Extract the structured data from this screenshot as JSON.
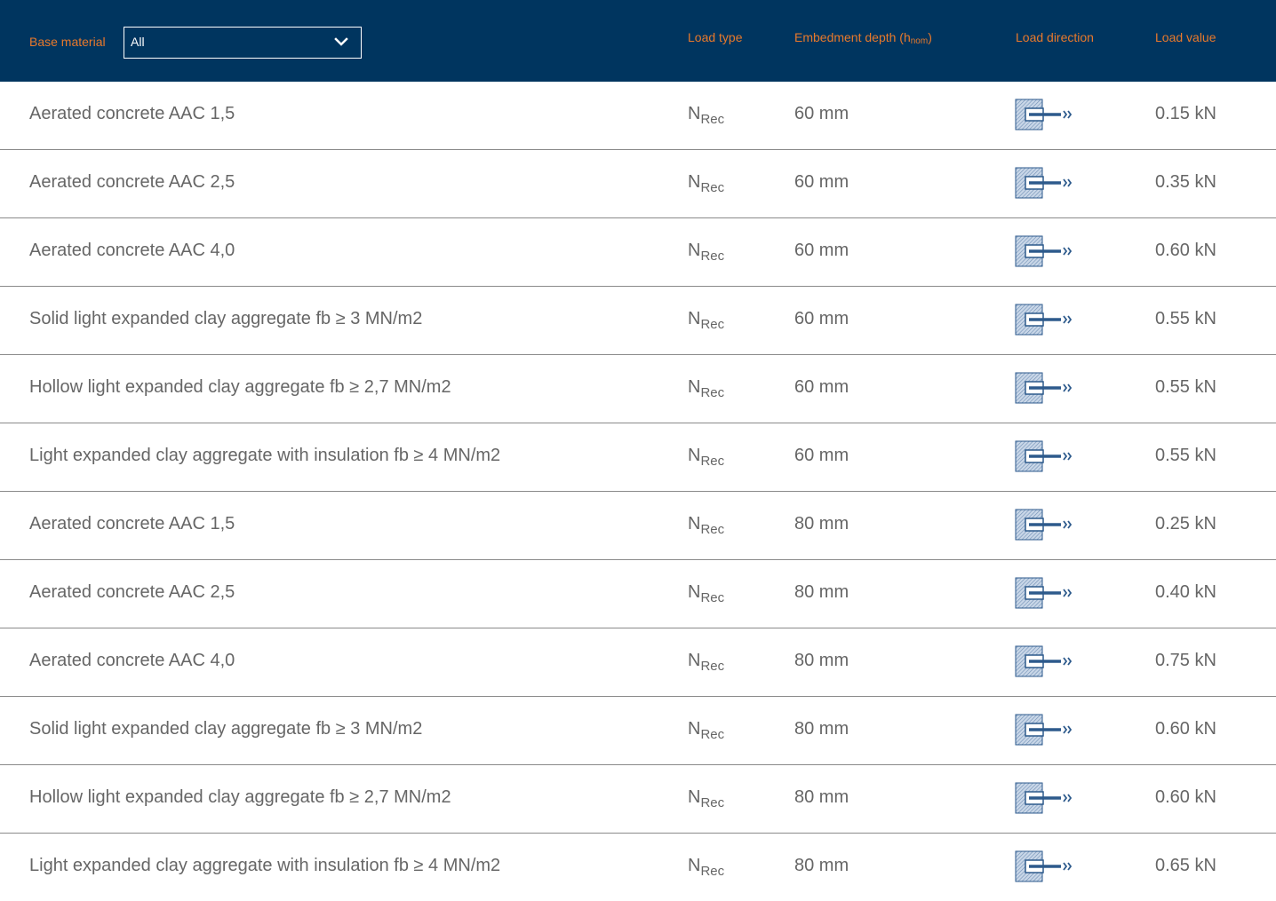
{
  "header": {
    "base_material_label": "Base material",
    "base_material_select": {
      "selected": "All"
    },
    "load_type_label": "Load type",
    "embedment_depth_label": "Embedment depth (h",
    "embedment_depth_sub": "nom",
    "embedment_depth_close": ")",
    "load_direction_label": "Load direction",
    "load_value_label": "Load value"
  },
  "icons": {
    "dropdown": "chevron-down-icon",
    "load_direction": "tension-load-direction-icon"
  },
  "colors": {
    "header_bg": "#00355f",
    "header_text": "#e8792b",
    "body_text": "#666666",
    "divider": "#8a8a8a"
  },
  "rows": [
    {
      "material": "Aerated concrete AAC 1,5",
      "load_type": "N",
      "load_type_sub": "Rec",
      "depth": "60 mm",
      "value": "0.15 kN"
    },
    {
      "material": "Aerated concrete AAC 2,5",
      "load_type": "N",
      "load_type_sub": "Rec",
      "depth": "60 mm",
      "value": "0.35 kN"
    },
    {
      "material": "Aerated concrete AAC 4,0",
      "load_type": "N",
      "load_type_sub": "Rec",
      "depth": "60 mm",
      "value": "0.60 kN"
    },
    {
      "material": "Solid light expanded clay aggregate fb ≥ 3 MN/m2",
      "load_type": "N",
      "load_type_sub": "Rec",
      "depth": "60 mm",
      "value": "0.55 kN"
    },
    {
      "material": "Hollow light expanded clay aggregate fb ≥ 2,7 MN/m2",
      "load_type": "N",
      "load_type_sub": "Rec",
      "depth": "60 mm",
      "value": "0.55 kN"
    },
    {
      "material": "Light expanded clay aggregate with insulation fb ≥ 4 MN/m2",
      "load_type": "N",
      "load_type_sub": "Rec",
      "depth": "60 mm",
      "value": "0.55 kN"
    },
    {
      "material": "Aerated concrete AAC 1,5",
      "load_type": "N",
      "load_type_sub": "Rec",
      "depth": "80 mm",
      "value": "0.25 kN"
    },
    {
      "material": "Aerated concrete AAC 2,5",
      "load_type": "N",
      "load_type_sub": "Rec",
      "depth": "80 mm",
      "value": "0.40 kN"
    },
    {
      "material": "Aerated concrete AAC 4,0",
      "load_type": "N",
      "load_type_sub": "Rec",
      "depth": "80 mm",
      "value": "0.75 kN"
    },
    {
      "material": "Solid light expanded clay aggregate fb ≥ 3 MN/m2",
      "load_type": "N",
      "load_type_sub": "Rec",
      "depth": "80 mm",
      "value": "0.60 kN"
    },
    {
      "material": "Hollow light expanded clay aggregate fb ≥ 2,7 MN/m2",
      "load_type": "N",
      "load_type_sub": "Rec",
      "depth": "80 mm",
      "value": "0.60 kN"
    },
    {
      "material": "Light expanded clay aggregate with insulation fb ≥ 4 MN/m2",
      "load_type": "N",
      "load_type_sub": "Rec",
      "depth": "80 mm",
      "value": "0.65 kN"
    }
  ]
}
